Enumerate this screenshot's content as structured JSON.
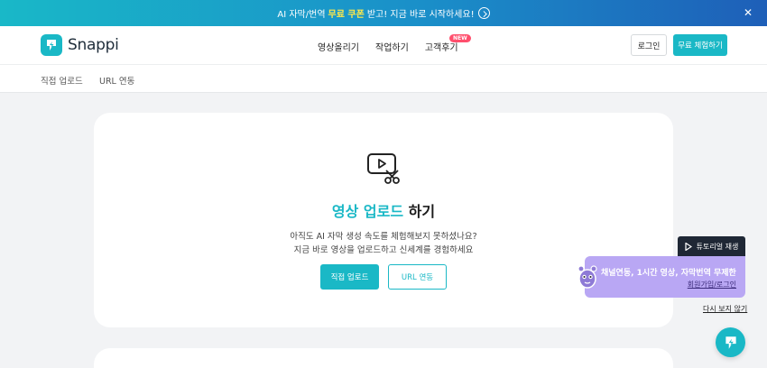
{
  "banner": {
    "text_before": "AI 자막/번역",
    "highlight": "무료 쿠폰",
    "text_after": "받고! 지금 바로 시작하세요!",
    "close_label": "✕"
  },
  "header": {
    "logo_text": "Snappi",
    "nav": [
      "영상올리기",
      "작업하기",
      "고객후기"
    ],
    "new_badge": "NEW",
    "login_label": "로그인",
    "trial_label": "무료 체험하기"
  },
  "subnav": {
    "items": [
      "직접 업로드",
      "URL 연동"
    ]
  },
  "card": {
    "title_accent": "영상 업로드",
    "title_rest": "하기",
    "desc_line1": "아직도 AI 자막 생성 속도를 체험해보지 못하셨나요?",
    "desc_line2": "지금 바로 영상을 업로드하고 신세계를 경험하세요",
    "direct_button": "직접 업로드",
    "url_button": "URL 연동"
  },
  "widget": {
    "tutorial_label": "튜토리얼 재생",
    "promo_text": "채널연동, 1시간 영상, 자막번역 무제한",
    "promo_link": "회원가입/로그인",
    "dismiss_label": "다시 보지 않기"
  },
  "colors": {
    "accent": "#1ab8c6",
    "promo_bg": "#b9a7f4",
    "banner_highlight": "#ffe94a"
  }
}
